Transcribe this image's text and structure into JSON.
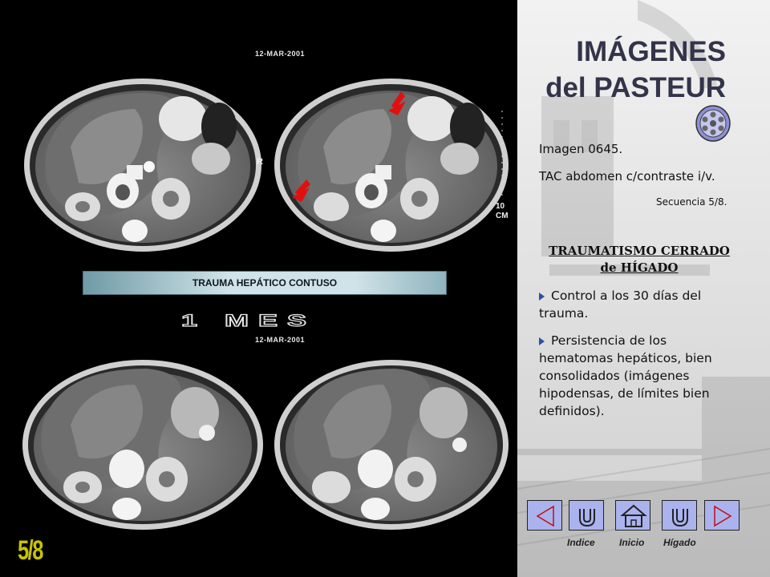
{
  "slide": {
    "ct_date_top": "12-MAR-2001",
    "ct_date_bottom": "12-MAR-2001",
    "ct_side_marker": "R",
    "ct_scale_label_a": "10",
    "ct_scale_label_b": "CM",
    "caption": "TRAUMA HEPÁTICO CONTUSO",
    "big_label": "1 MES",
    "page_indicator": "5/8"
  },
  "panel": {
    "title_line1": "IMÁGENES",
    "title_line2": "del PASTEUR",
    "image_id": "Imagen 0645.",
    "study": "TAC abdomen c/contraste i/v.",
    "sequence": "Secuencia  5/8.",
    "heading_line1": "TRAUMATISMO CERRADO",
    "heading_line2": "de HÍGADO",
    "bullet1": "Control a los 30 días del trauma.",
    "bullet2": "Persistencia de los hematomas hepáticos, bien consolidados (imágenes hipodensas, de límites bien definidos)."
  },
  "nav": {
    "prev_label": "",
    "next_label": "",
    "indice_label": "Indice",
    "inicio_label": "Inicio",
    "higado_label": "Hígado"
  },
  "colors": {
    "title": "#33334a",
    "button_fill": "#aab3ee",
    "arrow_red": "#e01010",
    "page_indicator": "#c9c200",
    "bullet_blue": "#2b4fa8"
  }
}
